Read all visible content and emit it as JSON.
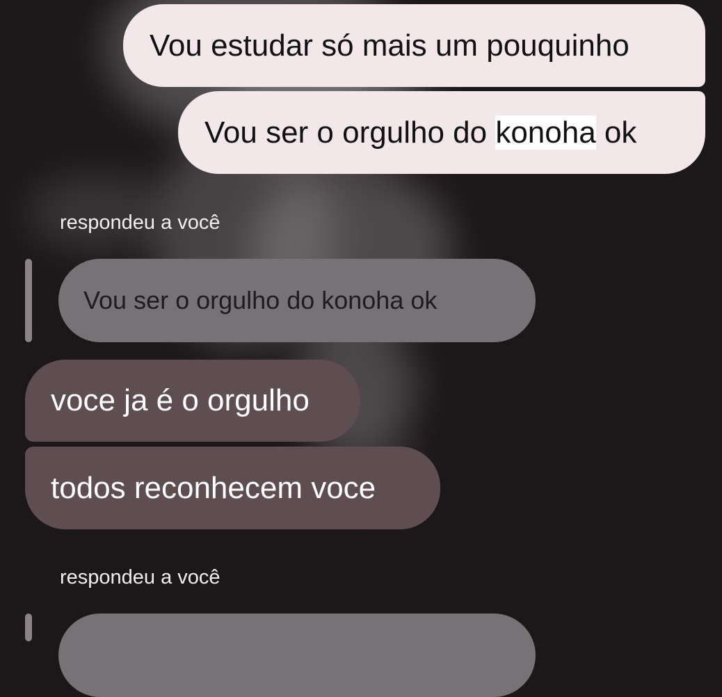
{
  "thread": {
    "sent_message_1": "Vou estudar só mais um pouquinho",
    "sent_message_2": {
      "before": "Vou ser o orgulho do ",
      "highlighted": "konoha",
      "after": " ok"
    },
    "reply_1": {
      "label": "respondeu a você",
      "quoted_text": "Vou ser o orgulho do konoha ok"
    },
    "received_messages": [
      "voce ja é o orgulho",
      "todos reconhecem voce"
    ],
    "reply_2": {
      "label": "respondeu a você"
    }
  },
  "colors": {
    "background": "#1c1718",
    "sent_bubble": "#f2e8e9",
    "received_bubble": "#5f4e51",
    "quoted_bubble": "#777276",
    "highlight": "#ffffff"
  }
}
